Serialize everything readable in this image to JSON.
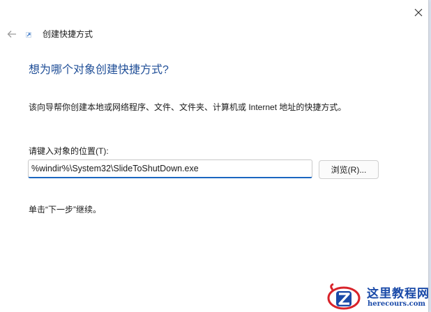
{
  "window": {
    "title": "创建快捷方式",
    "close_icon": "close-icon",
    "back_icon": "arrow-left-icon",
    "shortcut_icon": "shortcut-arrow-icon"
  },
  "content": {
    "heading": "想为哪个对象创建快捷方式?",
    "description": "该向导帮你创建本地或网络程序、文件、文件夹、计算机或 Internet 地址的快捷方式。",
    "field_label": "请键入对象的位置(T):",
    "location_value": "%windir%\\System32\\SlideToShutDown.exe",
    "browse_label": "浏览(R)...",
    "continue_hint": "单击“下一步”继续。"
  },
  "watermark": {
    "title": "这里教程网",
    "domain": "herecours.com"
  },
  "colors": {
    "heading": "#1f4e97",
    "input_accent": "#1a66c0",
    "watermark_blue": "#1a4aa8",
    "watermark_red": "#d8232a"
  }
}
